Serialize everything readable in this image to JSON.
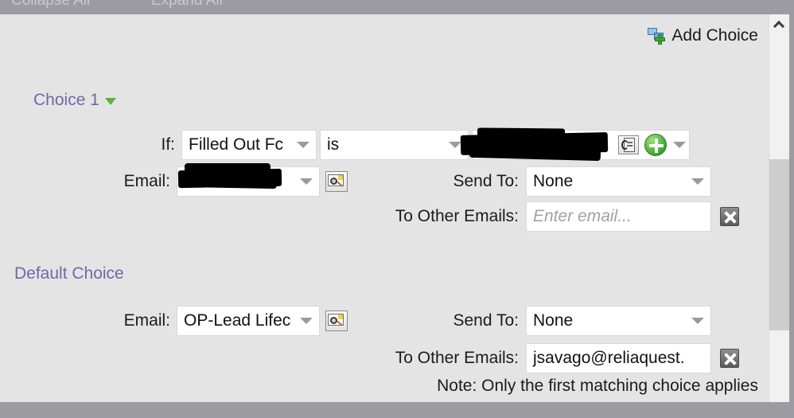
{
  "toolbar": {
    "collapse_all": "Collapse All",
    "expand_all": "Expand All"
  },
  "add_choice": {
    "label": "Add Choice",
    "icon": "add-choice-icon"
  },
  "choice1": {
    "title": "Choice 1",
    "toggle_icon": "collapse-triangle-icon",
    "if_label": "If:",
    "if_field": "Filled Out Fc",
    "operator": "is",
    "value": "",
    "value_redacted": true,
    "value_icon": "lookup-icon",
    "add_value_icon": "add-value-plus-icon",
    "email_label": "Email:",
    "email_value": "/R",
    "email_redacted": true,
    "email_preview_icon": "preview-magnifier-icon",
    "send_to_label": "Send To:",
    "send_to_value": "None",
    "to_other_emails_label": "To Other Emails:",
    "to_other_emails_value": "",
    "to_other_emails_placeholder": "Enter email...",
    "clear_icon": "clear-x-icon"
  },
  "default_choice": {
    "title": "Default Choice",
    "email_label": "Email:",
    "email_value": "OP-Lead Lifec",
    "email_preview_icon": "preview-magnifier-icon",
    "send_to_label": "Send To:",
    "send_to_value": "None",
    "to_other_emails_label": "To Other Emails:",
    "to_other_emails_value": "jsavago@reliaquest.",
    "clear_icon": "clear-x-icon"
  },
  "note": "Note: Only the first matching choice applies",
  "scrollbar": {
    "up_icon": "scroll-up-chevron-icon"
  },
  "colors": {
    "background": "#e4e4e4",
    "chrome": "#9b9ba1",
    "heading": "#6b6ba8",
    "accent_green": "#3da631",
    "field": "#ffffff"
  }
}
